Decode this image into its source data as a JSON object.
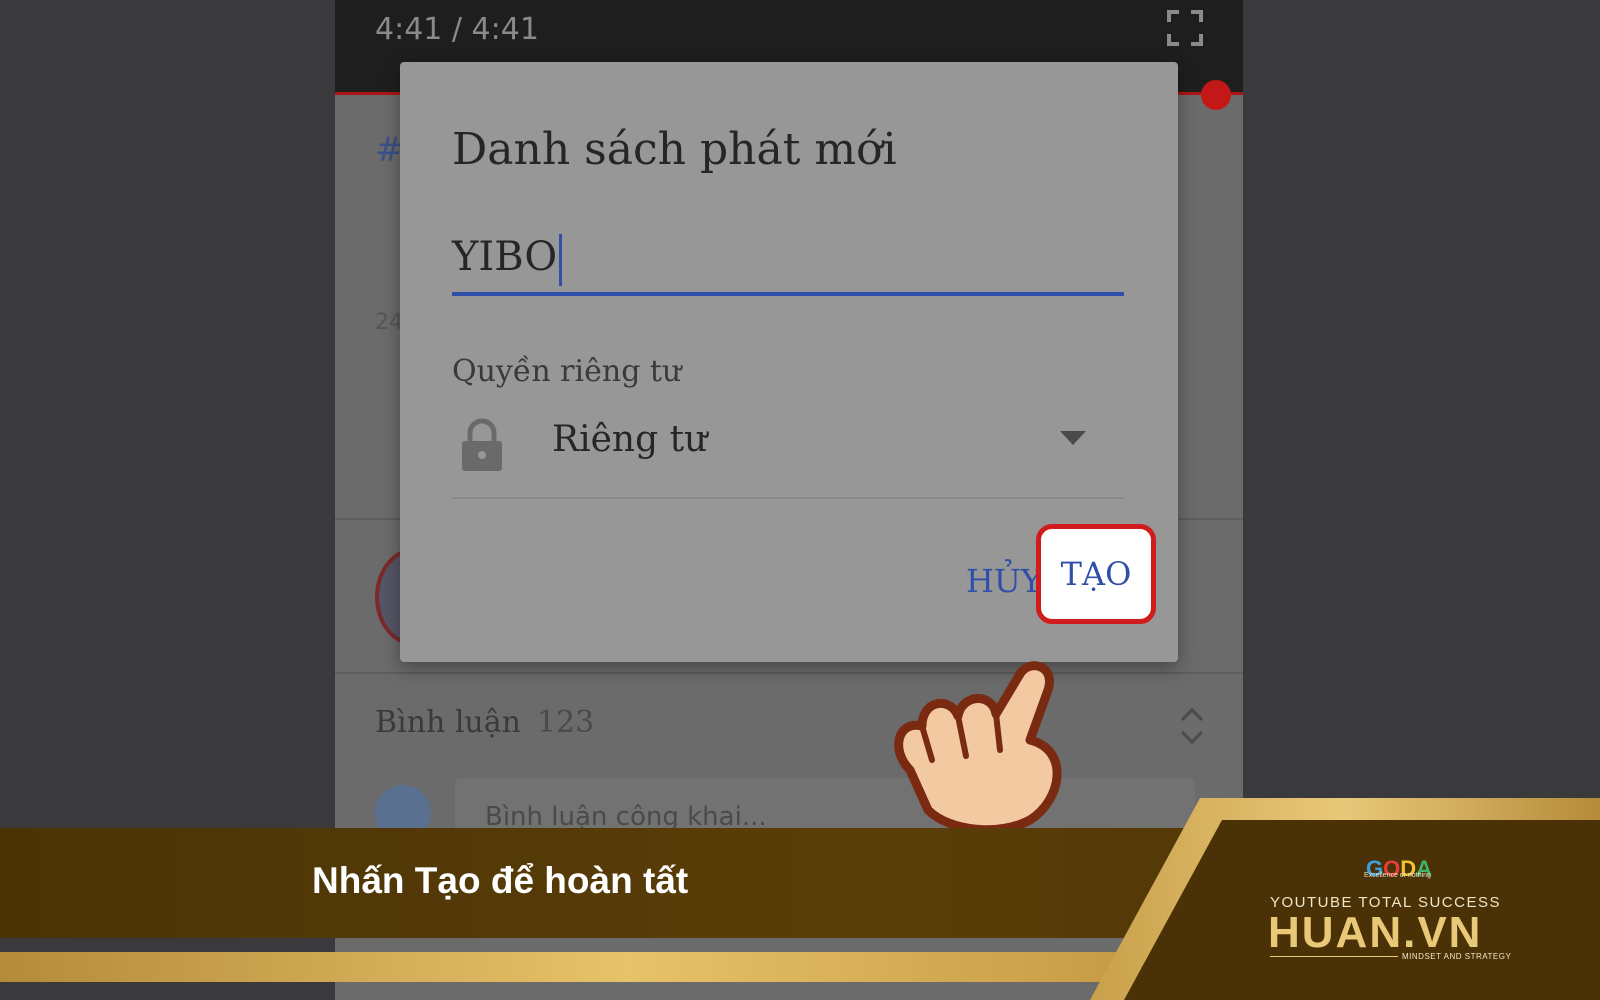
{
  "player": {
    "time": "4:41 / 4:41"
  },
  "background": {
    "hashtag": "#",
    "count_fragment": "24",
    "comments_label": "Bình luận",
    "comments_count": "123",
    "comment_placeholder": "Bình luận công khai..."
  },
  "dialog": {
    "title": "Danh sách phát mới",
    "name_value": "YIBO",
    "privacy_label": "Quyền riêng tư",
    "privacy_value": "Riêng tư",
    "cancel_label": "HỦY",
    "create_label": "TẠO"
  },
  "banner": {
    "caption": "Nhấn Tạo để hoàn tất"
  },
  "logo": {
    "goda": "GODA",
    "goda_tagline": "Excellence or nothing",
    "tagline_top": "YOUTUBE TOTAL SUCCESS",
    "brand": "HUAN.VN",
    "tagline_bottom": "MINDSET AND STRATEGY"
  },
  "colors": {
    "accent_blue": "#2f4fa8",
    "highlight_red": "#d01c1c",
    "gold": "#e9c978",
    "banner_brown": "#5b3e08"
  },
  "icons": [
    "fullscreen-icon",
    "lock-icon",
    "dropdown-arrow-icon",
    "expand-chevron-icon",
    "pointing-hand-icon"
  ]
}
